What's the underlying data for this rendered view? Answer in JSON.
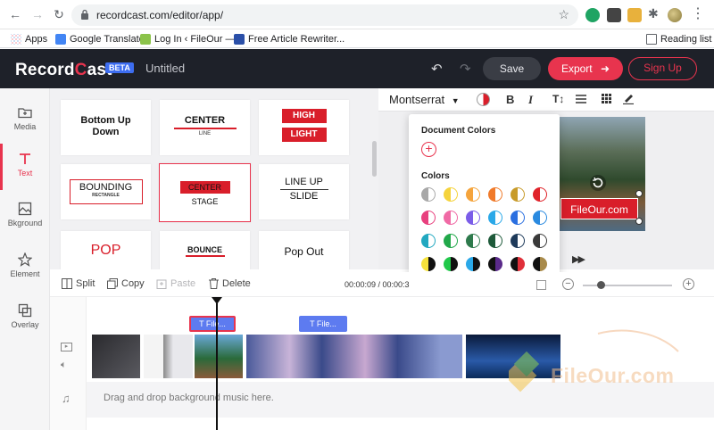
{
  "browser": {
    "url": "recordcast.com/editor/app/",
    "bookmarks": [
      {
        "label": "Apps"
      },
      {
        "label": "Google Translate"
      },
      {
        "label": "Log In ‹ FileOur —..."
      },
      {
        "label": "Free Article Rewriter..."
      }
    ],
    "reading_list": "Reading list"
  },
  "header": {
    "logo_left": "Record",
    "logo_c": "C",
    "logo_right": "ast",
    "beta": "BETA",
    "doc_title": "Untitled",
    "save": "Save",
    "export": "Export",
    "signup": "Sign Up"
  },
  "sidebar": {
    "items": [
      {
        "label": "Media"
      },
      {
        "label": "Text"
      },
      {
        "label": "Bkground"
      },
      {
        "label": "Element"
      },
      {
        "label": "Overlay"
      }
    ]
  },
  "templates": {
    "t1a": "Bottom Up",
    "t1b": "Down",
    "t2a": "CENTER",
    "t2b": "LINE",
    "t3a": "HIGH",
    "t3b": "LIGHT",
    "t4a": "BOUNDING",
    "t4b": "RECTANGLE",
    "t5a": "CENTER",
    "t5b": "STAGE",
    "t6a": "LINE UP",
    "t6b": "SLIDE",
    "t7": "POP",
    "t8": "BOUNCE",
    "t9": "Pop Out"
  },
  "text_toolbar": {
    "font": "Montserrat",
    "bold": "B",
    "italic": "I"
  },
  "color_picker": {
    "document_colors": "Document Colors",
    "colors": "Colors",
    "swatch_rows": [
      [
        "#a8a8a8",
        "#f5d33c",
        "#f5a43c",
        "#f07a2a",
        "#c89b2a",
        "#e0232a"
      ],
      [
        "#e8407e",
        "#f06aa5",
        "#7b5de8",
        "#2aa8e8",
        "#2a6fe0",
        "#2a8ae0"
      ],
      [
        "#22a8c0",
        "#21a84a",
        "#2e7a4c",
        "#1e5a3a",
        "#1e3a5a",
        "#3a3a3a"
      ],
      [
        "#111111",
        "#111111",
        "#111111",
        "#5a2a8a",
        "#e0303a",
        "#a88a4a"
      ]
    ]
  },
  "canvas": {
    "watermark_text": "FileOur.com"
  },
  "edit": {
    "split": "Split",
    "copy": "Copy",
    "paste": "Paste",
    "delete": "Delete",
    "time": "00:00:09 / 00:00:3"
  },
  "timeline": {
    "text_track_1": "File...",
    "text_track_2": "File...",
    "music_hint": "Drag and drop background music here."
  },
  "watermark": {
    "text": "FileOur.com"
  }
}
